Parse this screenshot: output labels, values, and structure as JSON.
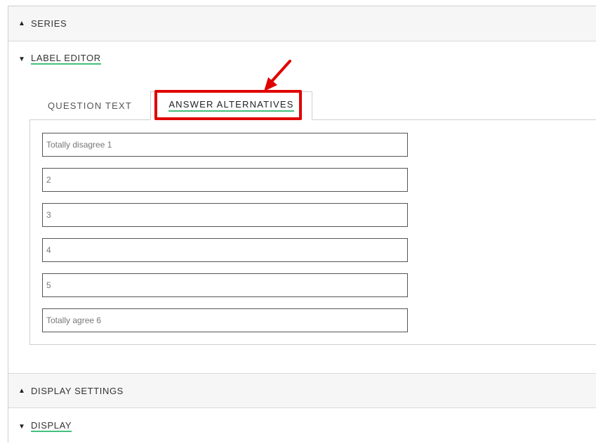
{
  "sections": {
    "series": {
      "label": "SERIES",
      "arrow": "▲"
    },
    "label_editor": {
      "label": "LABEL EDITOR",
      "arrow": "▼"
    },
    "display_settings": {
      "label": "DISPLAY SETTINGS",
      "arrow": "▲"
    },
    "display": {
      "label": "DISPLAY",
      "arrow": "▼"
    }
  },
  "tabs": {
    "question_text": "QUESTION TEXT",
    "answer_alternatives": "ANSWER ALTERNATIVES",
    "active": "answer_alternatives"
  },
  "answers": [
    "Totally disagree 1",
    "2",
    "3",
    "4",
    "5",
    "Totally agree 6"
  ],
  "annotation": {
    "color": "#e00000",
    "shape": "rectangle-with-arrow"
  },
  "accent_color": "#43c07c"
}
